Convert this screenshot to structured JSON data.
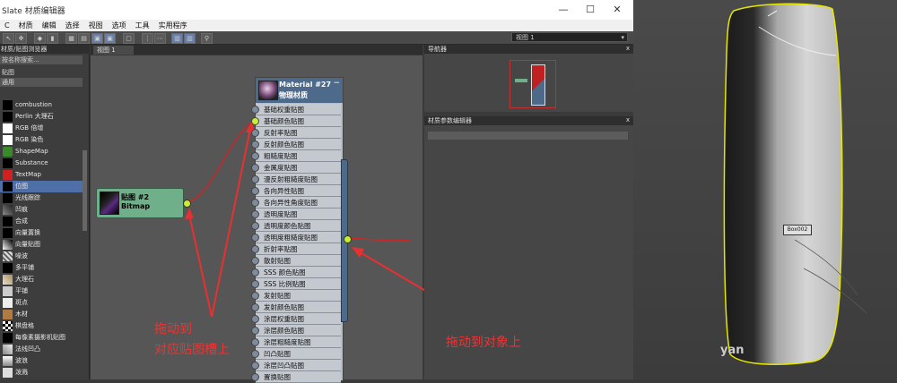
{
  "window": {
    "title": "Slate 材质编辑器",
    "controls": [
      "—",
      "☐",
      "✕"
    ]
  },
  "menu": [
    "C",
    "材质",
    "编辑",
    "选择",
    "视图",
    "选项",
    "工具",
    "实用程序"
  ],
  "toolbar": {
    "view_select": "视图 1"
  },
  "left_panel": {
    "header": "材质/贴图浏览器",
    "search_placeholder": "按名称搜索...",
    "category": "贴图",
    "subcategory": "通用",
    "items": [
      {
        "label": "combustion",
        "icon": "black-swatch"
      },
      {
        "label": "Perlin 大理石",
        "icon": "black-swatch"
      },
      {
        "label": "RGB 倍增",
        "icon": "white-swatch"
      },
      {
        "label": "RGB 染色",
        "icon": "white-swatch"
      },
      {
        "label": "ShapeMap",
        "icon": "shapemap-icon"
      },
      {
        "label": "Substance",
        "icon": "black-swatch"
      },
      {
        "label": "TextMap",
        "icon": "text-icon"
      },
      {
        "label": "位图",
        "icon": "black-swatch"
      },
      {
        "label": "光线跟踪",
        "icon": "black-swatch"
      },
      {
        "label": "凹痕",
        "icon": "dent-swatch"
      },
      {
        "label": "合成",
        "icon": "black-swatch"
      },
      {
        "label": "向量置换",
        "icon": "black-swatch"
      },
      {
        "label": "向量贴图",
        "icon": "vector-swatch"
      },
      {
        "label": "噪波",
        "icon": "noise-swatch"
      },
      {
        "label": "多平铺",
        "icon": "black-swatch"
      },
      {
        "label": "大理石",
        "icon": "marble-swatch"
      },
      {
        "label": "平铺",
        "icon": "tile-swatch"
      },
      {
        "label": "斑点",
        "icon": "speckle-swatch"
      },
      {
        "label": "木材",
        "icon": "wood-swatch"
      },
      {
        "label": "棋盘格",
        "icon": "checker-swatch"
      },
      {
        "label": "每像素摄影机贴图",
        "icon": "black-swatch"
      },
      {
        "label": "法线凹凸",
        "icon": "normal-swatch"
      },
      {
        "label": "波浪",
        "icon": "wave-swatch"
      },
      {
        "label": "泼溅",
        "icon": "splat-swatch"
      }
    ],
    "selected_index": 7
  },
  "canvas": {
    "tab_label": "视图 1"
  },
  "bitmap_node": {
    "title": "贴图 #2",
    "subtitle": "Bitmap"
  },
  "material_node": {
    "title": "Material #27",
    "subtitle": "物理材质",
    "collapse": "−",
    "slots": [
      "基础权重贴图",
      "基础颜色贴图",
      "反射率贴图",
      "反射颜色贴图",
      "粗糙度贴图",
      "金属度贴图",
      "漫反射粗糙度贴图",
      "各向异性贴图",
      "各向异性角度贴图",
      "透明度贴图",
      "透明度颜色贴图",
      "透明度粗糙度贴图",
      "折射率贴图",
      "散射贴图",
      "SSS 颜色贴图",
      "SSS 比例贴图",
      "发射贴图",
      "发射颜色贴图",
      "涂层权重贴图",
      "涂层颜色贴图",
      "涂层粗糙度贴图",
      "凹凸贴图",
      "涂层凹凸贴图",
      "置换贴图"
    ],
    "connected_slot": 1
  },
  "navigator": {
    "header": "导航器",
    "close": "x"
  },
  "mpe": {
    "header": "材质参数编辑器",
    "close": "x"
  },
  "viewport": {
    "object_label": "Box002"
  },
  "annotations": {
    "left_line1": "拖动到",
    "left_line2": "对应贴图槽上",
    "right": "拖动到对象上"
  },
  "watermark": "yan",
  "colors": {
    "arrow": "#e83030",
    "bitmap_node": "#6fb08a",
    "material_header": "#4e6a8a",
    "socket_active": "#c8f030"
  }
}
